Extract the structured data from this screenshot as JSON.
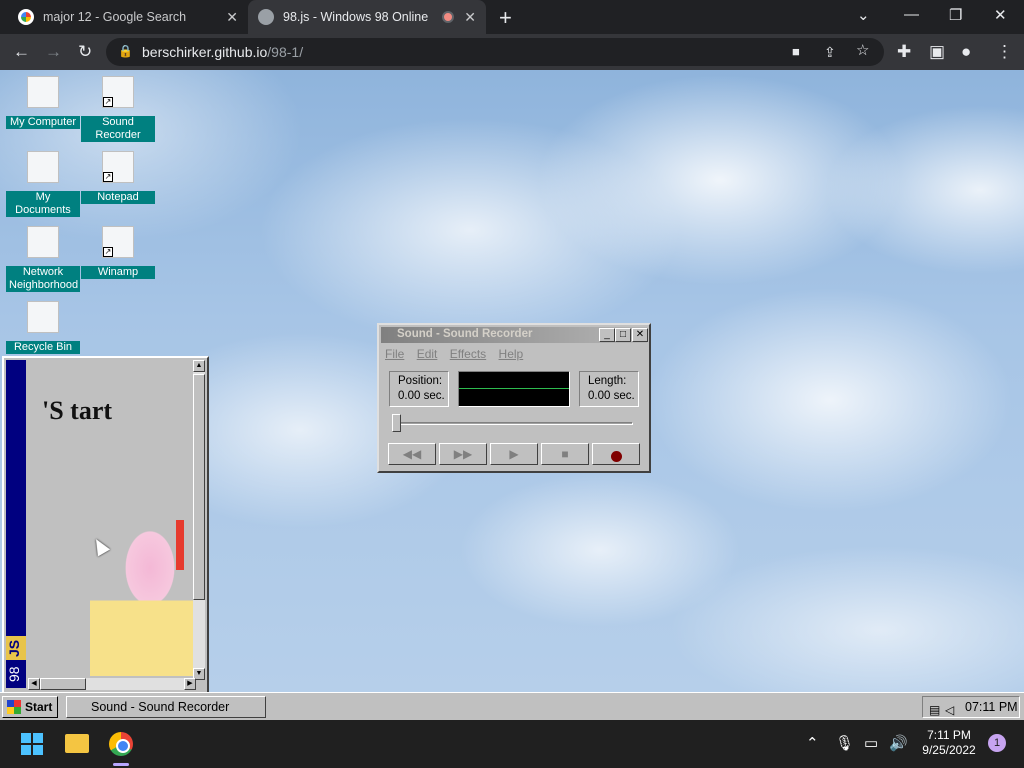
{
  "browser": {
    "tabs": [
      {
        "title": "major 12 - Google Search",
        "active": false
      },
      {
        "title": "98.js - Windows 98 Online",
        "active": true
      }
    ],
    "url_host": "berschirker.github.io",
    "url_path": "/98-1/"
  },
  "desktop": {
    "icons": [
      {
        "label": "My Computer",
        "shortcut": false
      },
      {
        "label": "Sound Recorder",
        "shortcut": true
      },
      {
        "label": "My Documents",
        "shortcut": false
      },
      {
        "label": "Notepad",
        "shortcut": true
      },
      {
        "label": "Network Neighborhood",
        "shortcut": false
      },
      {
        "label": "Winamp",
        "shortcut": true
      },
      {
        "label": "Recycle Bin",
        "shortcut": false
      }
    ]
  },
  "start_window": {
    "heading": "'S tart",
    "side_badge": "JS",
    "side_label": "98"
  },
  "sound_recorder": {
    "title": "Sound - Sound Recorder",
    "menu": [
      "File",
      "Edit",
      "Effects",
      "Help"
    ],
    "position_label": "Position:",
    "position_value": "0.00 sec.",
    "length_label": "Length:",
    "length_value": "0.00 sec.",
    "controls": [
      "◀◀",
      "▶▶",
      "▶",
      "■",
      ""
    ]
  },
  "win98_taskbar": {
    "start_label": "Start",
    "task_item": "Sound - Sound Recorder",
    "clock": "07:11 PM"
  },
  "os_taskbar": {
    "time": "7:11 PM",
    "date": "9/25/2022",
    "notification_count": "1"
  }
}
